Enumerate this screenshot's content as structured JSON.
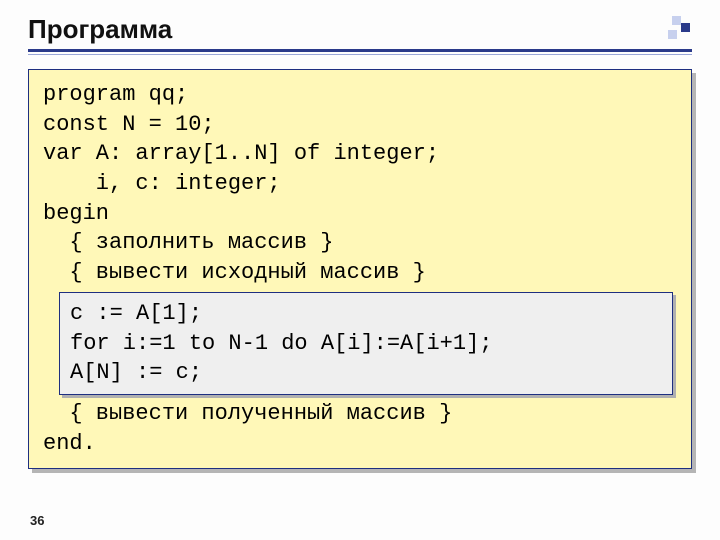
{
  "title": "Программа",
  "page_number": "36",
  "code": {
    "l1": "program qq;",
    "l2": "const N = 10;",
    "l3": "var A: array[1..N] of integer;",
    "l4": "    i, c: integer;",
    "l5": "begin",
    "l6": "  { заполнить массив }",
    "l7": "  { вывести исходный массив }",
    "inner": {
      "l1": "c := A[1];",
      "l2": "for i:=1 to N-1 do A[i]:=A[i+1];",
      "l3": "A[N] := c;"
    },
    "l8": "  { вывести полученный массив }",
    "l9": "end."
  }
}
